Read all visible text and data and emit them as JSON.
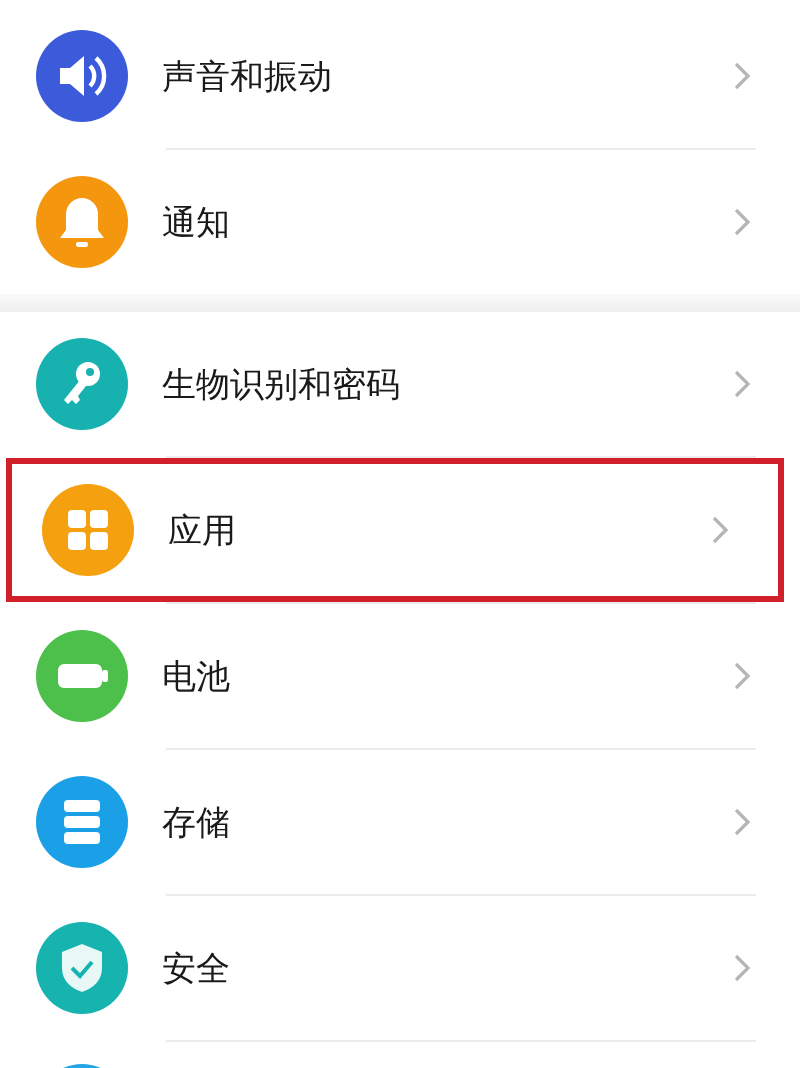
{
  "groups": [
    {
      "items": [
        {
          "label": "声音和振动",
          "kind": "speaker",
          "color": "#3b5bdb",
          "highlighted": false
        },
        {
          "label": "通知",
          "kind": "bell",
          "color": "#f5960f",
          "highlighted": false
        }
      ]
    },
    {
      "items": [
        {
          "label": "生物识别和密码",
          "kind": "key",
          "color": "#17b2b0",
          "highlighted": false
        },
        {
          "label": "应用",
          "kind": "apps",
          "color": "#f5a00f",
          "highlighted": true
        },
        {
          "label": "电池",
          "kind": "battery",
          "color": "#4cc04a",
          "highlighted": false
        },
        {
          "label": "存储",
          "kind": "storage",
          "color": "#1ba0e8",
          "highlighted": false
        },
        {
          "label": "安全",
          "kind": "shield",
          "color": "#17b3ae",
          "highlighted": false
        },
        {
          "kind": "partial",
          "color": "#22a6e6"
        }
      ]
    }
  ]
}
